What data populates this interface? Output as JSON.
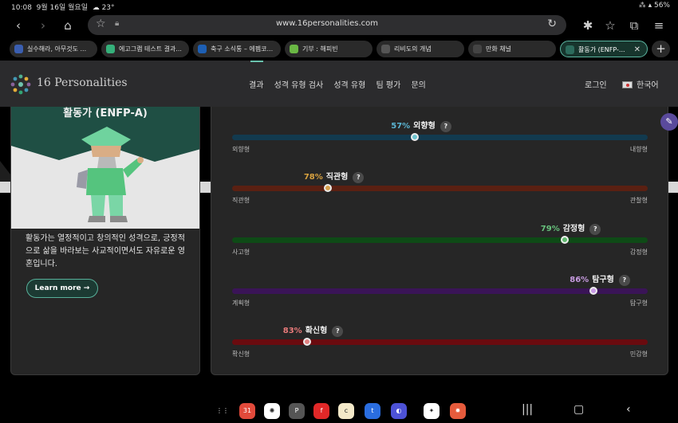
{
  "status_bar": {
    "time": "10:08",
    "date": "9월 16일 월요일",
    "weather": "☁ 23°",
    "battery": "56%"
  },
  "browser": {
    "url": "www.16personalities.com",
    "tabs": [
      {
        "label": "실수해라, 아무것도 ...",
        "icon": "twitter-icon",
        "color": "#3a5eb0"
      },
      {
        "label": "에고그램 테스트 결과...",
        "icon": "triangle-icon",
        "color": "#35b07a"
      },
      {
        "label": "축구 소식통 – 에펨코...",
        "icon": "fm-icon",
        "color": "#1d5fb4"
      },
      {
        "label": "기부 : 해피빈",
        "icon": "leaf-icon",
        "color": "#6ab744"
      },
      {
        "label": "리비도의 개념",
        "icon": "wiki-icon",
        "color": "#555555"
      },
      {
        "label": "만화 채널",
        "icon": "channel-icon",
        "color": "#444444"
      },
      {
        "label": "활동가 (ENFP-...",
        "icon": "sixteen-icon",
        "color": "#2c6b5c",
        "active": true
      }
    ]
  },
  "site": {
    "logo_text": "16 Personalities",
    "nav": [
      "결과",
      "성격 유형 검사",
      "성격 유형",
      "팀 평가",
      "문의"
    ],
    "login": "로그인",
    "language": "한국어"
  },
  "profile_card": {
    "title": "활동가 (ENFP-A)",
    "description": "활동가는 열정적이고 창의적인 성격으로, 긍정적으로 삶을 바라보는 사교적이면서도 자유로운 영혼입니다.",
    "button": "Learn more →"
  },
  "traits": [
    {
      "pct": "57%",
      "name": "외향형",
      "left": "외향형",
      "right": "내향형",
      "position": 0.44,
      "bar_color": "#123a4f",
      "pct_color": "#5bb5d3",
      "dot_color": "#6cc3cf"
    },
    {
      "pct": "78%",
      "name": "직관형",
      "left": "직관형",
      "right": "관찰형",
      "position": 0.23,
      "bar_color": "#5a2012",
      "pct_color": "#d9a23f",
      "dot_color": "#d6a04c"
    },
    {
      "pct": "79%",
      "name": "감정형",
      "left": "사고형",
      "right": "감정형",
      "position": 0.8,
      "bar_color": "#0e4a16",
      "pct_color": "#67c17c",
      "dot_color": "#5fb96e"
    },
    {
      "pct": "86%",
      "name": "탐구형",
      "left": "계획형",
      "right": "탐구형",
      "position": 0.87,
      "bar_color": "#3a1457",
      "pct_color": "#c79be0",
      "dot_color": "#c99ae6"
    },
    {
      "pct": "83%",
      "name": "확신형",
      "left": "확신형",
      "right": "민감형",
      "position": 0.18,
      "bar_color": "#6a0b0f",
      "pct_color": "#e87a7a",
      "dot_color": "#e08181"
    }
  ],
  "taskbar": {
    "apps": [
      {
        "icon": "apps-grid-icon",
        "color": "#000000",
        "glyph": "⋮⋮"
      },
      {
        "icon": "calendar-icon",
        "color": "#e24a3b",
        "glyph": "31"
      },
      {
        "icon": "chatgpt-icon",
        "color": "#ffffff",
        "glyph": "✺"
      },
      {
        "icon": "p-app-icon",
        "color": "#555555",
        "glyph": "P"
      },
      {
        "icon": "flipboard-icon",
        "color": "#e12828",
        "glyph": "f"
      },
      {
        "icon": "cremo-icon",
        "color": "#f4e9c9",
        "glyph": "c"
      },
      {
        "icon": "tving-icon",
        "color": "#2a6de0",
        "glyph": "t"
      },
      {
        "icon": "internet-icon",
        "color": "#4d52d6",
        "glyph": "◐"
      },
      {
        "icon": "bixby-icon",
        "color": "#ffffff",
        "glyph": "✦"
      },
      {
        "icon": "sun-app-icon",
        "color": "#e65b3c",
        "glyph": "✹"
      }
    ]
  }
}
